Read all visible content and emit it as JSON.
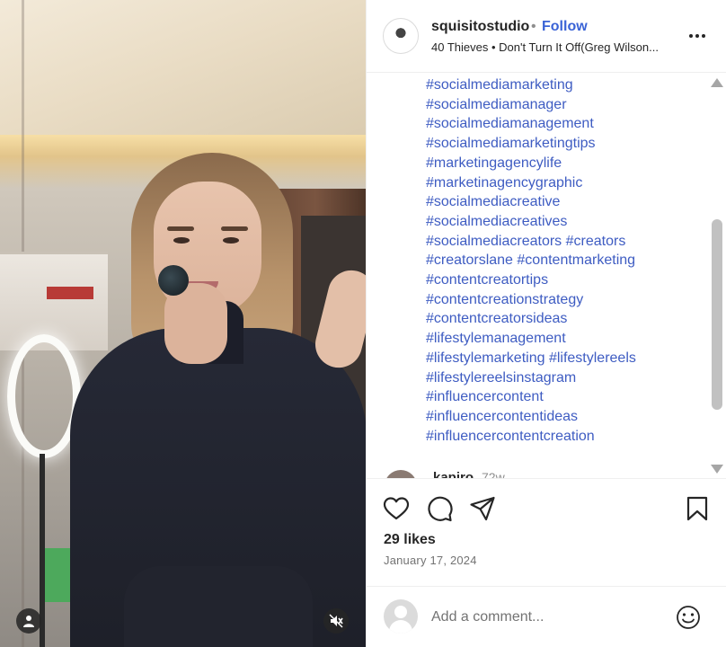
{
  "post": {
    "username": "squisitostudio",
    "separator": "•",
    "follow_label": "Follow",
    "audio": "40 Thieves • Don't Turn It Off(Greg Wilson...",
    "more_icon": "more-horizontal-icon"
  },
  "caption": {
    "hashtag_lines": [
      "#socialmediamarketing",
      "#socialmediamanager",
      "#socialmediamanagement",
      "#socialmediamarketingtips",
      "#marketingagencylife",
      "#marketinagencygraphic",
      "#socialmediacreative",
      "#socialmediacreatives",
      "#socialmediacreators #creators",
      "#creatorslane #contentmarketing",
      "#contentcreatortips",
      "#contentcreationstrategy",
      "#contentcreatorsideas",
      "#lifestylemanagement",
      "#lifestylemarketing #lifestylereels",
      "#lifestylereelsinstagram",
      "#influencercontent",
      "#influencercontentideas",
      "#influencercontentcreation"
    ],
    "comment_preview_user": "kapiro",
    "comment_preview_time": "72w"
  },
  "actions": {
    "likes": "29 likes",
    "date": "January 17, 2024"
  },
  "comment_box": {
    "placeholder": "Add a comment..."
  },
  "colors": {
    "link": "#3e5cc2",
    "follow": "#3a63d6",
    "text": "#262626",
    "muted": "#737373"
  }
}
